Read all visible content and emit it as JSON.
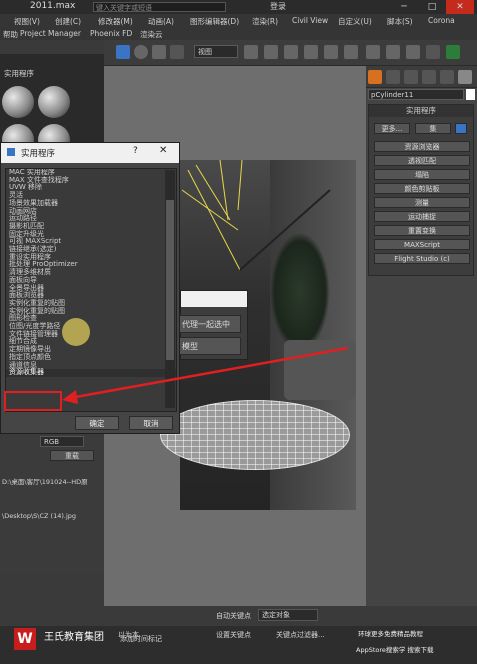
{
  "titlebar": {
    "filename": "2011.max",
    "search_placeholder": "键入关键字或短语",
    "login": "登录"
  },
  "menu": {
    "items": [
      "视图(V)",
      "创建(C)",
      "修改器(M)",
      "动画(A)",
      "图形编辑器(D)",
      "渲染(R)",
      "Civil View",
      "自定义(U)",
      "脚本(S)",
      "Corona"
    ],
    "items2": [
      "帮助",
      "Project Manager",
      "Phoenix FD",
      "渲染云"
    ]
  },
  "toolbar": {
    "view_select": "视图"
  },
  "material_editor": {
    "title": "实用程序"
  },
  "command_panel": {
    "object_name": "pCylinder11",
    "rollout_title": "实用程序",
    "more_button": "更多...",
    "set_button": "集",
    "buttons": [
      "资源浏览器",
      "透视匹配",
      "塌陷",
      "颜色剪贴板",
      "测量",
      "运动捕捉",
      "重置变换",
      "MAXScript",
      "Flight Studio (c)"
    ]
  },
  "dialog": {
    "title": "实用程序",
    "help": "?",
    "items": [
      "MAC 实用程序",
      "MAX 文件查找程序",
      "UVW 移除",
      "灵活",
      "场景效果加载器",
      "动画网店",
      "运动路径",
      "摄影机匹配",
      "固定升级光",
      "可视 MAXScript",
      "链接继承(选定)",
      "重设实用程序",
      "批处理 ProOptimizer",
      "清理多维材质",
      "面板向导",
      "全景导出器",
      "面板浏览器",
      "实例化重复的贴图",
      "实例化重复的贴图",
      "图形检查",
      "位图/光度学路径",
      "文件链接管理器",
      "细节合成",
      "定期镜像导出",
      "指定顶点颜色",
      "通道信息",
      "资源收集器"
    ],
    "ok": "确定",
    "cancel": "取消"
  },
  "popup": {
    "btn1": "代理一起选中",
    "btn2": "模型"
  },
  "lower_panel": {
    "dropdown": "RGB",
    "button": "重载",
    "path1": "D:\\桌面\\客厅\\191024--HD原",
    "path2": "\\Desktop\\S\\CZ (14).jpg"
  },
  "status": {
    "auto_key": "自动关键点",
    "select_object": "选定对象",
    "set_key": "设置关键点",
    "key_filter": "关键点过滤器...",
    "label1": "添加时间标记"
  },
  "watermark": {
    "logo": "W",
    "brand": "王氏教育集团",
    "sub": "以为本",
    "right": "环球更多免费精品教程",
    "store": "AppStore搜索学 搜索下载"
  }
}
